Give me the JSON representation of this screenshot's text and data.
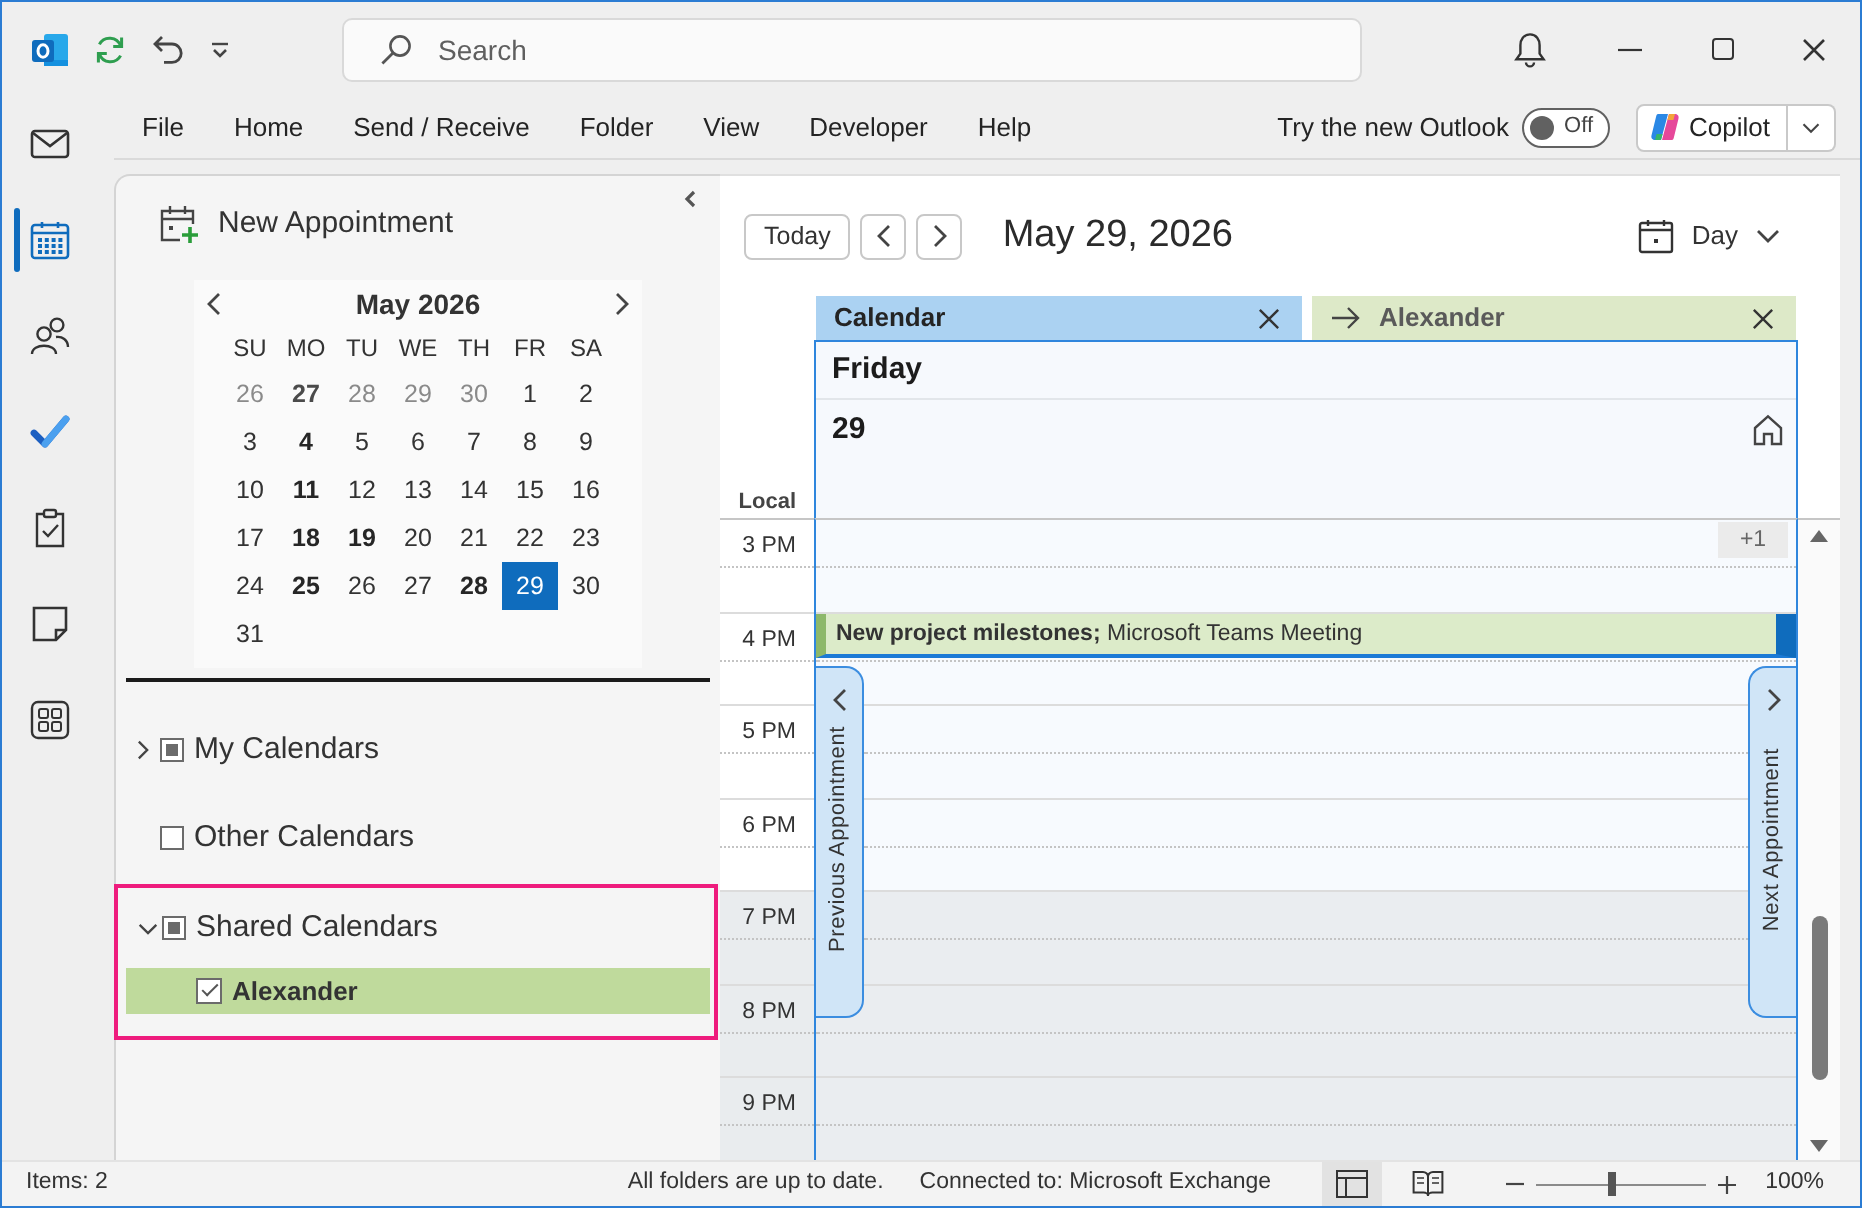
{
  "title_bar": {
    "search": {
      "placeholder": "Search"
    }
  },
  "ribbon": {
    "tabs": [
      "File",
      "Home",
      "Send / Receive",
      "Folder",
      "View",
      "Developer",
      "Help"
    ],
    "new_outlook": {
      "label": "Try the new Outlook",
      "on": false,
      "state": "Off"
    },
    "copilot": {
      "label": "Copilot"
    }
  },
  "nav_rail": {
    "items": [
      {
        "kind": "mail",
        "selected": false
      },
      {
        "kind": "calendar",
        "selected": true
      },
      {
        "kind": "people",
        "selected": false
      },
      {
        "kind": "todo",
        "selected": false
      },
      {
        "kind": "tasks",
        "selected": false
      },
      {
        "kind": "notes",
        "selected": false
      },
      {
        "kind": "apps",
        "selected": false
      }
    ]
  },
  "folder_pane": {
    "new_appointment": "New Appointment",
    "mini_calendar": {
      "month": "May 2026",
      "weekdays": [
        "SU",
        "MO",
        "TU",
        "WE",
        "TH",
        "FR",
        "SA"
      ],
      "weeks": [
        [
          {
            "day": "26",
            "outside": true,
            "busy": false,
            "selected": false
          },
          {
            "day": "27",
            "outside": true,
            "busy": true,
            "selected": false
          },
          {
            "day": "28",
            "outside": true,
            "busy": false,
            "selected": false
          },
          {
            "day": "29",
            "outside": true,
            "busy": false,
            "selected": false
          },
          {
            "day": "30",
            "outside": true,
            "busy": false,
            "selected": false
          },
          {
            "day": "1",
            "outside": false,
            "busy": false,
            "selected": false
          },
          {
            "day": "2",
            "outside": false,
            "busy": false,
            "selected": false
          }
        ],
        [
          {
            "day": "3",
            "outside": false,
            "busy": false,
            "selected": false
          },
          {
            "day": "4",
            "outside": false,
            "busy": true,
            "selected": false
          },
          {
            "day": "5",
            "outside": false,
            "busy": false,
            "selected": false
          },
          {
            "day": "6",
            "outside": false,
            "busy": false,
            "selected": false
          },
          {
            "day": "7",
            "outside": false,
            "busy": false,
            "selected": false
          },
          {
            "day": "8",
            "outside": false,
            "busy": false,
            "selected": false
          },
          {
            "day": "9",
            "outside": false,
            "busy": false,
            "selected": false
          }
        ],
        [
          {
            "day": "10",
            "outside": false,
            "busy": false,
            "selected": false
          },
          {
            "day": "11",
            "outside": false,
            "busy": true,
            "selected": false
          },
          {
            "day": "12",
            "outside": false,
            "busy": false,
            "selected": false
          },
          {
            "day": "13",
            "outside": false,
            "busy": false,
            "selected": false
          },
          {
            "day": "14",
            "outside": false,
            "busy": false,
            "selected": false
          },
          {
            "day": "15",
            "outside": false,
            "busy": false,
            "selected": false
          },
          {
            "day": "16",
            "outside": false,
            "busy": false,
            "selected": false
          }
        ],
        [
          {
            "day": "17",
            "outside": false,
            "busy": false,
            "selected": false
          },
          {
            "day": "18",
            "outside": false,
            "busy": true,
            "selected": false
          },
          {
            "day": "19",
            "outside": false,
            "busy": true,
            "selected": false
          },
          {
            "day": "20",
            "outside": false,
            "busy": false,
            "selected": false
          },
          {
            "day": "21",
            "outside": false,
            "busy": false,
            "selected": false
          },
          {
            "day": "22",
            "outside": false,
            "busy": false,
            "selected": false
          },
          {
            "day": "23",
            "outside": false,
            "busy": false,
            "selected": false
          }
        ],
        [
          {
            "day": "24",
            "outside": false,
            "busy": false,
            "selected": false
          },
          {
            "day": "25",
            "outside": false,
            "busy": true,
            "selected": false
          },
          {
            "day": "26",
            "outside": false,
            "busy": false,
            "selected": false
          },
          {
            "day": "27",
            "outside": false,
            "busy": false,
            "selected": false
          },
          {
            "day": "28",
            "outside": false,
            "busy": true,
            "selected": false
          },
          {
            "day": "29",
            "outside": false,
            "busy": false,
            "selected": true
          },
          {
            "day": "30",
            "outside": false,
            "busy": false,
            "selected": false
          }
        ],
        [
          {
            "day": "31",
            "outside": false,
            "busy": false,
            "selected": false
          }
        ]
      ]
    },
    "calendar_groups": [
      {
        "label": "My Calendars",
        "expanded": false,
        "checked": false,
        "mixed": true,
        "highlighted": false
      },
      {
        "label": "Other Calendars",
        "checked": false,
        "mixed": false,
        "highlighted": false
      },
      {
        "label": "Shared Calendars",
        "expanded": true,
        "checked": false,
        "mixed": true,
        "highlighted": true,
        "children": [
          {
            "label": "Alexander",
            "checked": true,
            "selected": true,
            "color": "#bfda9c"
          }
        ]
      }
    ]
  },
  "calendar_view": {
    "today": "Today",
    "date": "May 29, 2026",
    "view": "Day",
    "tabs": [
      {
        "label": "Calendar",
        "color": "#abd2f2",
        "selected": true,
        "overlay": false
      },
      {
        "label": "Alexander",
        "color": "#dde9c8",
        "selected": false,
        "overlay": true
      }
    ],
    "day": {
      "weekday": "Friday",
      "date": "29"
    },
    "timezone": "Local",
    "hours": [
      {
        "label": "3 PM",
        "work": true,
        "more": "+1"
      },
      {
        "label": "4 PM",
        "work": true,
        "events": [
          {
            "text": "**New project milestones;** Microsoft Teams Meeting"
          }
        ]
      },
      {
        "label": "5 PM",
        "work": true
      },
      {
        "label": "6 PM",
        "work": true
      },
      {
        "label": "7 PM",
        "work": false
      },
      {
        "label": "8 PM",
        "work": false
      },
      {
        "label": "9 PM",
        "work": false
      }
    ],
    "previous_appointment": "Previous Appointment",
    "next_appointment": "Next Appointment"
  },
  "status_bar": {
    "items": "Items: 2",
    "sync": "All folders are up to date.",
    "connection": "Connected to: Microsoft Exchange",
    "views": [
      {
        "kind": "normal",
        "selected": true
      },
      {
        "kind": "reading",
        "selected": false
      }
    ],
    "zoom": {
      "level": 0.45,
      "reading": "100%"
    }
  }
}
